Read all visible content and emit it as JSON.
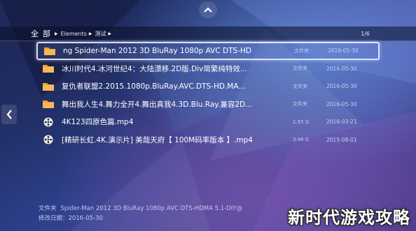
{
  "breadcrumb": {
    "root": "全部",
    "items": [
      "Elements",
      "测试"
    ]
  },
  "page_indicator": "1/6",
  "files": [
    {
      "name": "ng Spider-Man 2012 3D BluRay 1080p AVC DTS-HD",
      "type": "文件夹",
      "date": "2016-05-30",
      "icon": "folder-icon",
      "selected": true
    },
    {
      "name": "冰川时代4.冰河世纪4：大陆漂移.2D版.Div简繁纯特效...",
      "type": "文件夹",
      "date": "2016-05-30",
      "icon": "folder-icon",
      "selected": false
    },
    {
      "name": "复仇者联盟2.2015.1080p.BluRay.AVC.DTS-HD.MA...",
      "type": "文件夹",
      "date": "2016-05-30",
      "icon": "folder-icon",
      "selected": false
    },
    {
      "name": "舞出我人生4.舞力全开4.舞出真我4.3D.Blu.Ray.兼容2D...",
      "type": "文件夹",
      "date": "2016-05-30",
      "icon": "folder-icon",
      "selected": false
    },
    {
      "name": "4K123四原色篇.mp4",
      "type": "2.55 G",
      "date": "2016-03-21",
      "icon": "film-reel-icon",
      "selected": false
    },
    {
      "name": "[精研长虹.4K.演示片] 美哉天府【 100M码率版本 】.mp4",
      "type": "3.46 G",
      "date": "2015-08-01",
      "icon": "film-reel-icon",
      "selected": false
    }
  ],
  "footer": {
    "folder_label": "文件夹",
    "folder_value": "Spider-Man 2012 3D BluRay 1080p AVC DTS-HDMA 5.1-DIY@",
    "date_label": "修改日期：",
    "date_value": "2016-05-30"
  },
  "watermark": "新时代游戏攻略",
  "colors": {
    "folder": "#f0a23a",
    "selection_border": "#ebf0ff"
  }
}
